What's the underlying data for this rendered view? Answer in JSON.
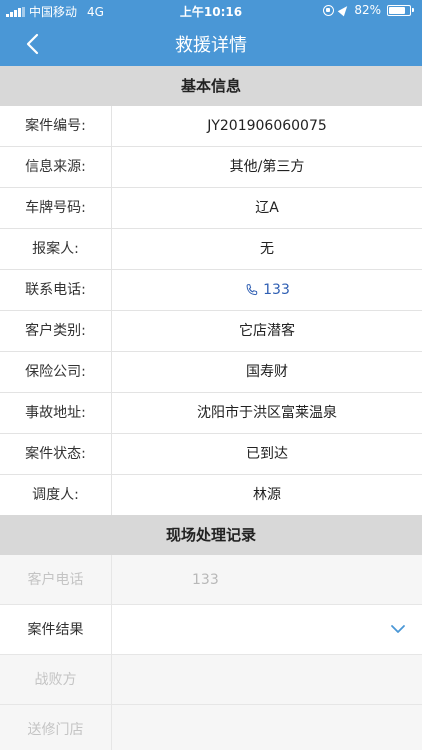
{
  "status": {
    "carrier": "中国移动",
    "network": "4G",
    "time": "上午10:16",
    "battery": "82%",
    "battery_level": 0.82
  },
  "nav": {
    "title": "救援详情",
    "back_icon": "chevron-left-icon"
  },
  "basic": {
    "title": "基本信息",
    "rows": [
      {
        "label": "案件编号:",
        "value": "JY201906060075"
      },
      {
        "label": "信息来源:",
        "value": "其他/第三方"
      },
      {
        "label": "车牌号码:",
        "value": "辽A"
      },
      {
        "label": "报案人:",
        "value": "无"
      },
      {
        "label": "联系电话:",
        "value": "133"
      },
      {
        "label": "客户类别:",
        "value": "它店潜客"
      },
      {
        "label": "保险公司:",
        "value": "国寿财"
      },
      {
        "label": "事故地址:",
        "value": "沈阳市于洪区富莱温泉"
      },
      {
        "label": "案件状态:",
        "value": "已到达"
      },
      {
        "label": "调度人:",
        "value": "林源"
      }
    ]
  },
  "onsite": {
    "title": "现场处理记录",
    "rows": [
      {
        "label": "客户电话",
        "value": "133"
      },
      {
        "label": "案件结果",
        "value": ""
      },
      {
        "label": "战败方",
        "value": ""
      },
      {
        "label": "送修门店",
        "value": ""
      }
    ]
  },
  "colors": {
    "primary": "#4a97d6",
    "link": "#2f5fb3"
  }
}
